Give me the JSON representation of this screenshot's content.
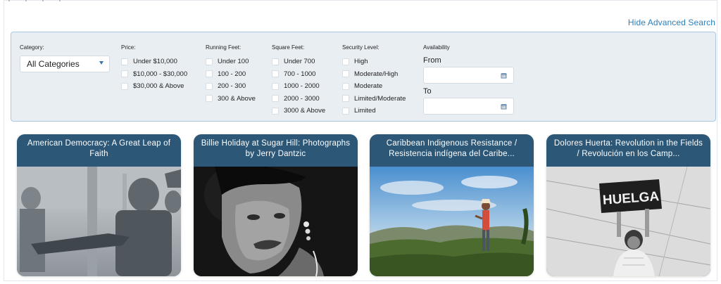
{
  "header": {
    "hide_advanced_label": "Hide Advanced Search"
  },
  "filters": {
    "category": {
      "label": "Category:",
      "selected": "All Categories"
    },
    "price": {
      "label": "Price:",
      "options": [
        "Under $10,000",
        "$10,000 - $30,000",
        "$30,000 & Above"
      ]
    },
    "running_feet": {
      "label": "Running Feet:",
      "options": [
        "Under 100",
        "100 - 200",
        "200 - 300",
        "300 & Above"
      ]
    },
    "square_feet": {
      "label": "Square Feet:",
      "options": [
        "Under 700",
        "700 - 1000",
        "1000 - 2000",
        "2000 - 3000",
        "3000 & Above"
      ]
    },
    "security_level": {
      "label": "Security Level:",
      "options": [
        "High",
        "Moderate/High",
        "Moderate",
        "Limited/Moderate",
        "Limited"
      ]
    },
    "availability": {
      "label": "Availability",
      "from_label": "From",
      "to_label": "To"
    }
  },
  "cards": [
    {
      "title": "American Democracy: A Great Leap of Faith"
    },
    {
      "title": "Billie Holiday at Sugar Hill: Photographs by Jerry Dantzic"
    },
    {
      "title": "Caribbean Indigenous Resistance / Resistencia indígena del Caribe..."
    },
    {
      "title": "Dolores Huerta: Revolution in the Fields / Revolución en los Camp...",
      "sign_text": "HUELGA"
    }
  ],
  "colors": {
    "accent": "#2f7fb8",
    "card_header": "#2c5777",
    "panel_bg": "#e9eef3",
    "panel_border": "#a9c7e3"
  },
  "icons": {
    "category_select": "chevron-down-icon",
    "date_picker": "calendar-icon"
  }
}
